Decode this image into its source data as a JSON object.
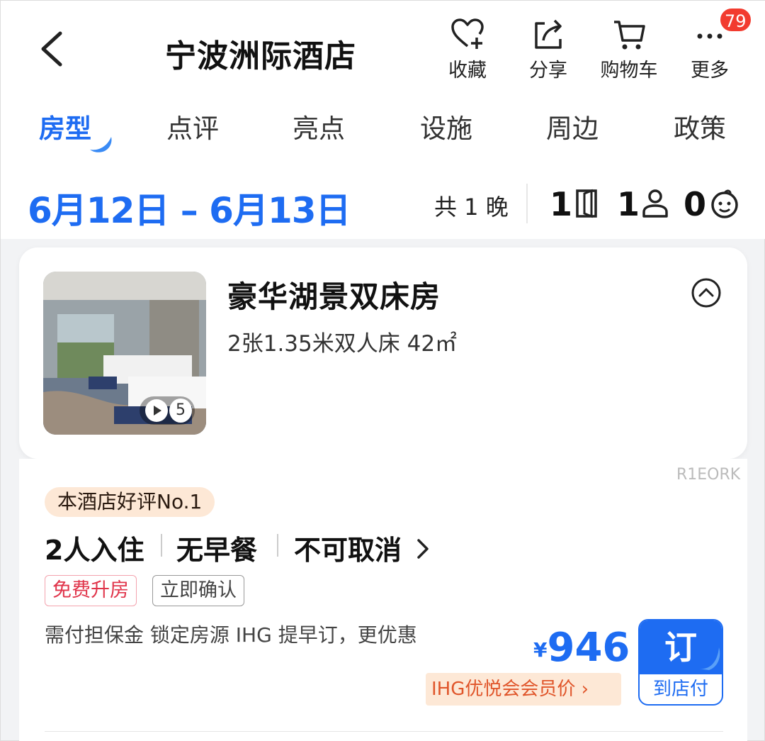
{
  "header": {
    "title": "宁波洲际酒店",
    "actions": [
      {
        "label": "收藏",
        "icon": "heart-plus-icon"
      },
      {
        "label": "分享",
        "icon": "share-icon"
      },
      {
        "label": "购物车",
        "icon": "cart-icon"
      },
      {
        "label": "更多",
        "icon": "more-icon"
      }
    ],
    "more_badge": "79"
  },
  "tabs": [
    "房型",
    "点评",
    "亮点",
    "设施",
    "周边",
    "政策"
  ],
  "active_tab": "房型",
  "stay": {
    "dates": "6月12日 – 6月13日",
    "nights": "共 1 晚",
    "rooms": "1",
    "adults": "1",
    "children": "0"
  },
  "room": {
    "name": "豪华湖景双床房",
    "spec": "2张1.35米双人床  42㎡",
    "media_count": "5"
  },
  "plan": {
    "code": "R1EORK",
    "rank_tag": "本酒店好评No.1",
    "conditions": [
      "2人入住",
      "无早餐",
      "不可取消"
    ],
    "tags": [
      "免费升房",
      "立即确认"
    ],
    "note": "需付担保金 锁定房源 IHG 提早订，更优惠",
    "currency": "¥",
    "price": "946",
    "member_price": "IHG优悦会会员价 ›",
    "book_label": "订",
    "pay_label": "到店付"
  },
  "colors": {
    "accent": "#1e6cf2",
    "badge": "#f23b2f",
    "warm": "#fde8d6"
  }
}
